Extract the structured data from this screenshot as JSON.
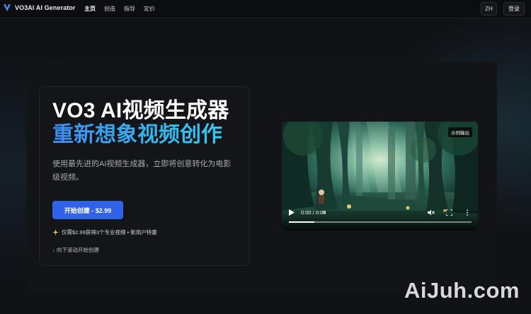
{
  "header": {
    "brand": "VO3AI AI Generator",
    "nav": [
      "主页",
      "创造",
      "指导",
      "定价"
    ],
    "lang_button": "ZH",
    "login_button": "登录"
  },
  "hero": {
    "title_line1": "VO3 AI视频生成器",
    "title_line2": "重新想象视频创作",
    "description": "使用最先进的AI视频生成器，立即将创意转化为电影级视频。",
    "cta_label": "开始创建 - $2.99",
    "offer_text": "仅需$2.99获得3个专业视频 • 新用户特惠",
    "scroll_hint": "↓ 向下滚动开始创建"
  },
  "video": {
    "badge": "示例输出",
    "time": "0:00 / 0:08",
    "progress": 0.14
  },
  "watermark": "AiJuh.com",
  "colors": {
    "accent": "#2f62e6",
    "gradient_start": "#3d8cf5",
    "gradient_end": "#33c9f2"
  }
}
